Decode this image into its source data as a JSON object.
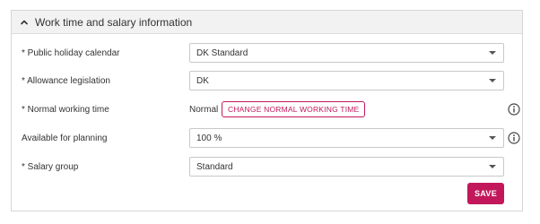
{
  "section": {
    "title": "Work time and salary information",
    "expanded_icon": "chevron-up-icon"
  },
  "fields": {
    "public_holiday_calendar": {
      "label": "* Public holiday calendar",
      "value": "DK Standard"
    },
    "allowance_legislation": {
      "label": "* Allowance legislation",
      "value": "DK"
    },
    "normal_working_time": {
      "label": "* Normal working time",
      "value": "Normal",
      "button_label": "CHANGE NORMAL WORKING TIME",
      "info_icon": "info-icon"
    },
    "available_for_planning": {
      "label": "Available for planning",
      "value": "100 %",
      "info_icon": "info-icon"
    },
    "salary_group": {
      "label": "* Salary group",
      "value": "Standard"
    }
  },
  "actions": {
    "save_label": "SAVE"
  },
  "colors": {
    "accent": "#c2185b",
    "header_bg": "#f2f2f2",
    "border": "#d6d6d6"
  }
}
